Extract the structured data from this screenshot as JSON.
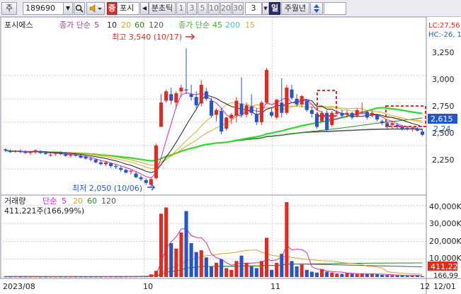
{
  "toolbar": {
    "market": "주",
    "code": "189690",
    "search_icon": "search-icon",
    "sound_icon": "speaker-icon",
    "flag": "증",
    "name": "포시",
    "period_unit": "분초틱",
    "periods": [
      "1",
      "3",
      "5",
      "10",
      "20",
      "30"
    ],
    "interval": "3",
    "day_btn": "일",
    "week_month_year": "주월년",
    "updown_icon": "updown-arrow-icon"
  },
  "price_panel": {
    "stock_name": "포시에스",
    "ma_label": "종가 단순",
    "ma_periods": [
      "5",
      "10",
      "20",
      "60",
      "120"
    ],
    "ma_colors": [
      "#c42bc7",
      "#222222",
      "#d9a520",
      "#1f8f1f",
      "#555555"
    ],
    "ma2_label": "종가 단순",
    "ma2_periods": [
      "45",
      "200",
      "15"
    ],
    "ma2_colors": [
      "#31d82f",
      "#44c5c0",
      "#d4b230"
    ],
    "high_label": "최고 3,540 (10/17)",
    "low_label": "최저 2,050 (10/06)",
    "lc_label": "LC:27,56",
    "hc_label": "HC:-26, 1",
    "current_price": "2,615",
    "partial_label": "2,24",
    "y_ticks": [
      "3,250",
      "3,000",
      "2,750",
      "2,500",
      "2,250"
    ],
    "colors": {
      "up": "#e02b21",
      "down": "#2456c9",
      "grid": "#c8c8d8"
    }
  },
  "volume_panel": {
    "title": "거래량",
    "ma_label": "단순",
    "ma_periods": [
      "5",
      "20",
      "60",
      "120"
    ],
    "ma_colors": [
      "#c42bc7",
      "#d9a520",
      "#1f8f1f",
      "#555555"
    ],
    "current": "411,221주(166,99%)",
    "y_ticks": [
      "40,000K",
      "30,000K",
      "20,000K",
      "10,000K"
    ],
    "badge_volume": "411,22",
    "badge_ratio": "166,99"
  },
  "x_axis": {
    "labels": [
      "2023/08",
      "10",
      "11",
      "12",
      "12/01"
    ]
  },
  "chart_data": {
    "type": "candlestick",
    "period": "daily",
    "y_range": [
      2000,
      3650
    ],
    "volume_range": [
      0,
      42000
    ],
    "volume_unit": "K shares",
    "high": {
      "value": 3540,
      "date": "10/17"
    },
    "low": {
      "value": 2050,
      "date": "10/06"
    },
    "last_price": 2615,
    "ohlc": [
      [
        2460,
        2470,
        2430,
        2450
      ],
      [
        2440,
        2460,
        2420,
        2430
      ],
      [
        2440,
        2450,
        2420,
        2440
      ],
      [
        2440,
        2460,
        2420,
        2430
      ],
      [
        2430,
        2450,
        2410,
        2420
      ],
      [
        2420,
        2440,
        2400,
        2430
      ],
      [
        2430,
        2460,
        2410,
        2450
      ],
      [
        2440,
        2450,
        2410,
        2420
      ],
      [
        2420,
        2440,
        2400,
        2410
      ],
      [
        2400,
        2420,
        2380,
        2400
      ],
      [
        2410,
        2430,
        2390,
        2420
      ],
      [
        2420,
        2440,
        2400,
        2410
      ],
      [
        2410,
        2430,
        2380,
        2390
      ],
      [
        2390,
        2410,
        2370,
        2400
      ],
      [
        2400,
        2420,
        2380,
        2390
      ],
      [
        2390,
        2400,
        2360,
        2370
      ],
      [
        2380,
        2400,
        2350,
        2360
      ],
      [
        2360,
        2380,
        2330,
        2350
      ],
      [
        2350,
        2360,
        2310,
        2320
      ],
      [
        2320,
        2340,
        2290,
        2300
      ],
      [
        2300,
        2330,
        2280,
        2320
      ],
      [
        2310,
        2320,
        2260,
        2280
      ],
      [
        2280,
        2300,
        2250,
        2270
      ],
      [
        2260,
        2280,
        2220,
        2240
      ],
      [
        2240,
        2250,
        2200,
        2210
      ],
      [
        2220,
        2240,
        2190,
        2230
      ],
      [
        2200,
        2220,
        2150,
        2160
      ],
      [
        2160,
        2180,
        2120,
        2140
      ],
      [
        2130,
        2150,
        2080,
        2100
      ],
      [
        2080,
        2150,
        2050,
        2140
      ],
      [
        2150,
        2520,
        2140,
        2500
      ],
      [
        2700,
        3050,
        2700,
        2960
      ],
      [
        2980,
        3100,
        2960,
        3080
      ],
      [
        3050,
        3120,
        2940,
        2980
      ],
      [
        2960,
        3080,
        2900,
        3060
      ],
      [
        3080,
        3150,
        3020,
        3120
      ],
      [
        3100,
        3540,
        3050,
        3090
      ],
      [
        3050,
        3150,
        2980,
        3020
      ],
      [
        3020,
        3080,
        2900,
        2930
      ],
      [
        2950,
        3200,
        2920,
        3150
      ],
      [
        3080,
        3120,
        2980,
        3000
      ],
      [
        2980,
        3010,
        2800,
        2820
      ],
      [
        2830,
        2900,
        2760,
        2880
      ],
      [
        2870,
        2900,
        2620,
        2650
      ],
      [
        2680,
        2810,
        2660,
        2800
      ],
      [
        2790,
        2850,
        2730,
        2830
      ],
      [
        2820,
        3020,
        2750,
        2980
      ],
      [
        2950,
        3230,
        2800,
        2830
      ],
      [
        2830,
        2960,
        2800,
        2930
      ],
      [
        2920,
        3050,
        2820,
        2850
      ],
      [
        2840,
        2900,
        2720,
        2750
      ],
      [
        2750,
        2980,
        2720,
        2960
      ],
      [
        2960,
        3330,
        2950,
        3310
      ],
      [
        2860,
        2900,
        2800,
        2820
      ],
      [
        2800,
        3000,
        2780,
        2990
      ],
      [
        2960,
        3220,
        2800,
        2850
      ],
      [
        2850,
        3150,
        2830,
        3120
      ],
      [
        3100,
        3150,
        2990,
        3010
      ],
      [
        3000,
        3050,
        2920,
        2940
      ],
      [
        2940,
        3040,
        2910,
        3030
      ],
      [
        2980,
        3000,
        2860,
        2880
      ],
      [
        2880,
        2920,
        2800,
        2840
      ],
      [
        2840,
        2860,
        2680,
        2700
      ],
      [
        2760,
        2870,
        2750,
        2850
      ],
      [
        2850,
        2880,
        2650,
        2670
      ],
      [
        2720,
        2870,
        2700,
        2850
      ],
      [
        2840,
        2880,
        2810,
        2850
      ],
      [
        2850,
        2880,
        2800,
        2820
      ],
      [
        2830,
        2880,
        2800,
        2850
      ],
      [
        2850,
        2860,
        2780,
        2800
      ],
      [
        2820,
        2900,
        2800,
        2880
      ],
      [
        2860,
        2960,
        2840,
        2860
      ],
      [
        2860,
        2880,
        2780,
        2800
      ],
      [
        2820,
        2870,
        2800,
        2850
      ],
      [
        2830,
        2840,
        2760,
        2780
      ],
      [
        2760,
        2780,
        2720,
        2740
      ],
      [
        2740,
        2760,
        2680,
        2700
      ],
      [
        2720,
        2760,
        2680,
        2740
      ],
      [
        2720,
        2740,
        2680,
        2700
      ],
      [
        2700,
        2720,
        2660,
        2680
      ],
      [
        2690,
        2710,
        2660,
        2680
      ],
      [
        2680,
        2700,
        2650,
        2690
      ],
      [
        2680,
        2700,
        2650,
        2660
      ],
      [
        2650,
        2680,
        2600,
        2615
      ]
    ],
    "volume": [
      300,
      250,
      280,
      240,
      260,
      220,
      300,
      250,
      240,
      230,
      260,
      240,
      250,
      230,
      260,
      240,
      250,
      230,
      260,
      240,
      300,
      280,
      260,
      250,
      300,
      320,
      350,
      400,
      600,
      1500,
      3500,
      35500,
      39000,
      19000,
      16000,
      25000,
      37000,
      19000,
      14000,
      15000,
      11000,
      6000,
      8000,
      10000,
      5000,
      4000,
      9000,
      12000,
      8000,
      6000,
      5000,
      9000,
      22000,
      4000,
      8000,
      13000,
      42000,
      9000,
      6000,
      7000,
      4000,
      3000,
      2500,
      4500,
      3000,
      2500,
      2000,
      1800,
      2200,
      1900,
      1700,
      2000,
      1600,
      1800,
      1500,
      1200,
      1100,
      1000,
      900,
      800,
      700,
      900,
      1000,
      411
    ]
  }
}
